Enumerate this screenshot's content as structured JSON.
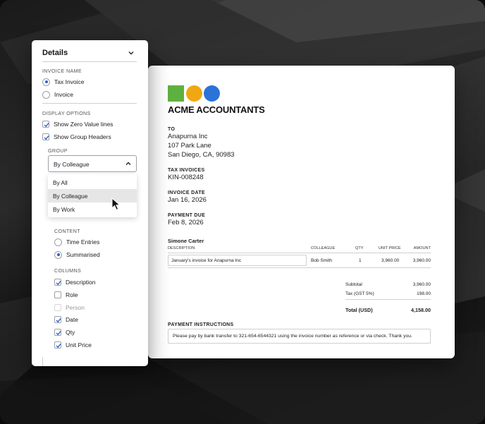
{
  "panel": {
    "title": "Details",
    "invoice_name": {
      "label": "INVOICE NAME",
      "options": [
        {
          "label": "Tax Invoice",
          "selected": true
        },
        {
          "label": "Invoice",
          "selected": false
        }
      ]
    },
    "display_options": {
      "label": "DISPLAY OPTIONS",
      "options": [
        {
          "label": "Show Zero Value lines",
          "checked": true
        },
        {
          "label": "Show Group Headers",
          "checked": true
        }
      ]
    },
    "group": {
      "label": "GROUP",
      "selected": "By Colleague",
      "options": [
        "By All",
        "By Colleague",
        "By Work"
      ],
      "highlighted": "By Colleague"
    },
    "content": {
      "label": "CONTENT",
      "options": [
        {
          "label": "Time Entries",
          "selected": false
        },
        {
          "label": "Summarised",
          "selected": true
        }
      ]
    },
    "columns": {
      "label": "COLUMNS",
      "options": [
        {
          "label": "Description",
          "checked": true,
          "disabled": false
        },
        {
          "label": "Role",
          "checked": false,
          "disabled": false
        },
        {
          "label": "Person",
          "checked": false,
          "disabled": true
        },
        {
          "label": "Date",
          "checked": true,
          "disabled": false
        },
        {
          "label": "Qty",
          "checked": true,
          "disabled": false
        },
        {
          "label": "Unit Price",
          "checked": true,
          "disabled": false
        }
      ]
    }
  },
  "invoice": {
    "logo_colors": [
      "#5fb13f",
      "#f0a812",
      "#2c72d8"
    ],
    "company": "ACME ACCOUNTANTS",
    "to": {
      "label": "TO",
      "name": "Anapurna Inc",
      "street": "107 Park Lane",
      "city": "San Diego, CA, 90983"
    },
    "tax_invoices": {
      "label": "TAX INVOICES",
      "value": "KIN-008248"
    },
    "invoice_date": {
      "label": "INVOICE DATE",
      "value": "Jan 16, 2026"
    },
    "payment_due": {
      "label": "PAYMENT DUE",
      "value": "Feb 8, 2026"
    },
    "group_name": "Simone Carter",
    "table": {
      "headers": [
        "DESCRIPTION",
        "COLLEAGUE",
        "QTY",
        "UNIT PRICE",
        "AMOUNT"
      ],
      "rows": [
        {
          "description": "January's invoice for Anapurna Inc",
          "colleague": "Bob Smith",
          "qty": "1",
          "unit_price": "3,960.00",
          "amount": "3,960.00"
        }
      ]
    },
    "totals": {
      "subtotal_label": "Subtotal",
      "subtotal": "3,960.00",
      "tax_label": "Tax (GST 5%)",
      "tax": "198.00",
      "total_label": "Total (USD)",
      "total": "4,158.00"
    },
    "payment_instructions": {
      "label": "PAYMENT INSTRUCTIONS",
      "text": "Please pay by bank transfer to 321-654-6544321 using the invoice number as reference or via check. Thank you."
    }
  }
}
